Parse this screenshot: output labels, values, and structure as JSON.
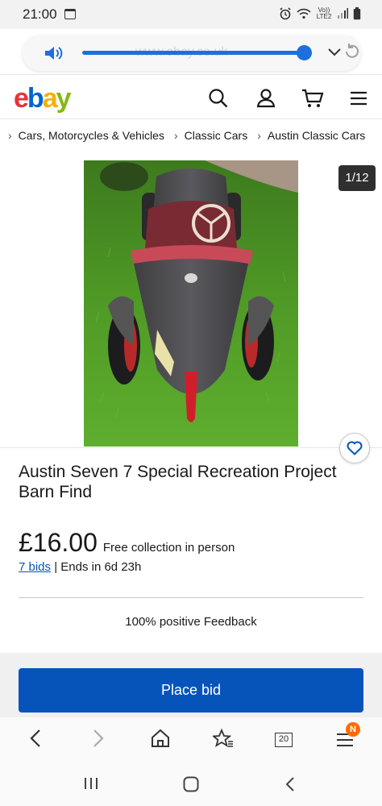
{
  "status_bar": {
    "time": "21:00",
    "network": "Vo)) LTE2"
  },
  "volume_overlay": {
    "url_hint": "www.ebay.co.uk",
    "level": 0.95
  },
  "header": {
    "logo_letters": [
      "e",
      "b",
      "a",
      "y"
    ],
    "icons": [
      "search-icon",
      "account-icon",
      "cart-icon",
      "menu-icon"
    ]
  },
  "breadcrumb": [
    "Cars, Motorcycles & Vehicles",
    "Classic Cars",
    "Austin Classic Cars"
  ],
  "gallery": {
    "counter": "1/12"
  },
  "listing": {
    "title": "Austin Seven 7 Special Recreation Project Barn Find",
    "price": "£16.00",
    "shipping": "Free collection in person",
    "bids": "7 bids",
    "ends": "| Ends in 6d 23h",
    "feedback": "100% positive Feedback",
    "place_bid": "Place bid"
  },
  "browser_nav": {
    "tabs_count": "20",
    "badge": "N"
  },
  "colors": {
    "primary": "#0654ba",
    "volume": "#1d6fe0",
    "badge": "#ff6a00"
  }
}
